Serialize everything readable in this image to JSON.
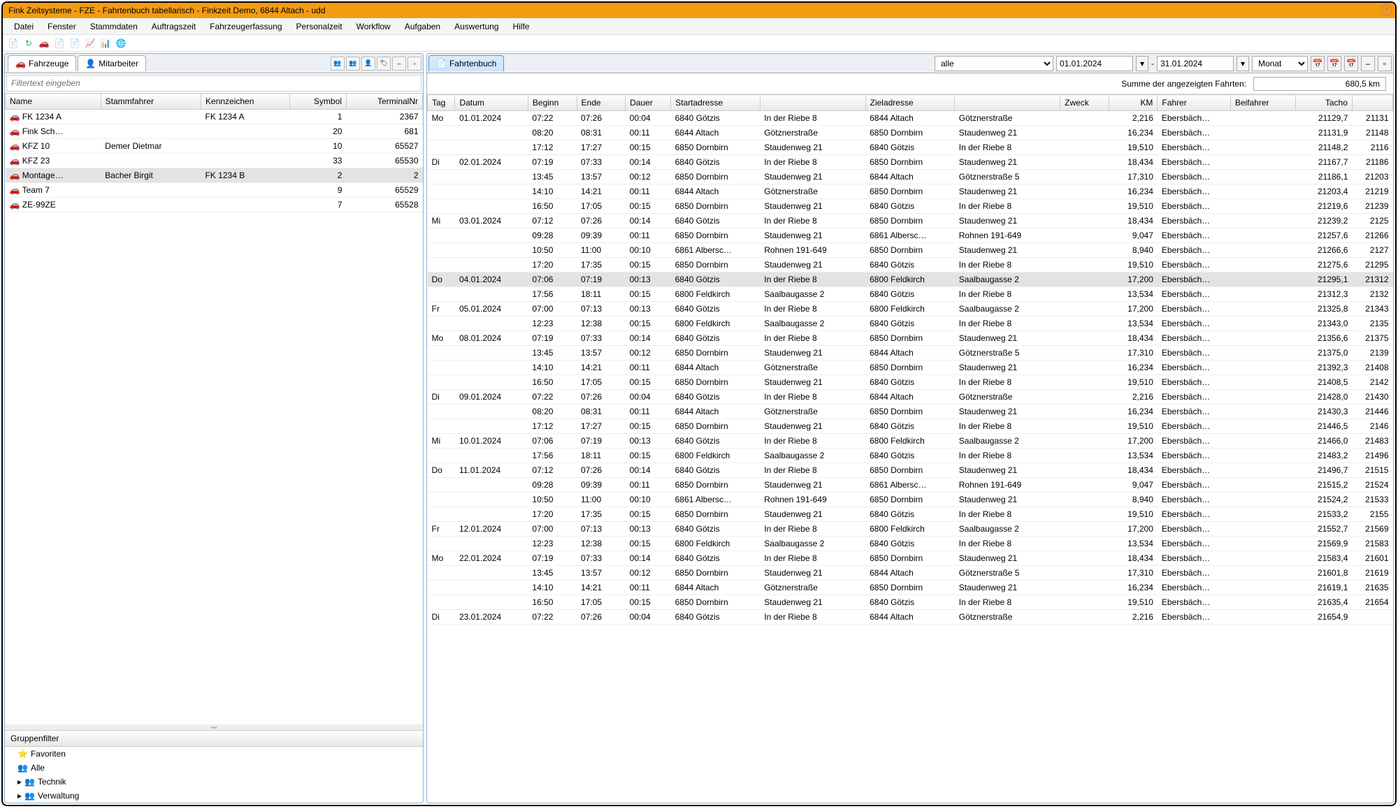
{
  "window_title": "Fink Zeitsysteme - FZE - Fahrtenbuch tabellarisch - Finkzeit Demo, 6844 Altach - udd",
  "menu": [
    "Datei",
    "Fenster",
    "Stammdaten",
    "Auftragszeit",
    "Fahrzeugerfassung",
    "Personalzeit",
    "Workflow",
    "Aufgaben",
    "Auswertung",
    "Hilfe"
  ],
  "left": {
    "tabs": [
      "Fahrzeuge",
      "Mitarbeiter"
    ],
    "filter_placeholder": "Filtertext eingeben",
    "cols": [
      "Name",
      "Stammfahrer",
      "Kennzeichen",
      "Symbol",
      "TerminalNr"
    ],
    "rows": [
      {
        "name": "FK 1234 A",
        "stamm": "",
        "kenn": "FK 1234 A",
        "sym": "1",
        "tnr": "2367"
      },
      {
        "name": "Fink Sch…",
        "stamm": "",
        "kenn": "",
        "sym": "20",
        "tnr": "681"
      },
      {
        "name": "KFZ 10",
        "stamm": "Demer Dietmar",
        "kenn": "",
        "sym": "10",
        "tnr": "65527"
      },
      {
        "name": "KFZ 23",
        "stamm": "",
        "kenn": "",
        "sym": "33",
        "tnr": "65530"
      },
      {
        "name": "Montage…",
        "stamm": "Bacher Birgit",
        "kenn": "FK 1234 B",
        "sym": "2",
        "tnr": "2",
        "sel": true
      },
      {
        "name": "Team 7",
        "stamm": "",
        "kenn": "",
        "sym": "9",
        "tnr": "65529"
      },
      {
        "name": "ZE-99ZE",
        "stamm": "",
        "kenn": "",
        "sym": "7",
        "tnr": "65528"
      }
    ],
    "group_header": "Gruppenfilter",
    "group_items": [
      "Favoriten",
      "Alle",
      "Technik",
      "Verwaltung"
    ]
  },
  "right": {
    "tab": "Fahrtenbuch",
    "filter_sel": "alle",
    "date_from": "01.01.2024",
    "date_to": "31.01.2024",
    "period": "Monat",
    "sum_label": "Summe der angezeigten Fahrten:",
    "sum_value": "680,5 km",
    "cols": [
      "Tag",
      "Datum",
      "Beginn",
      "Ende",
      "Dauer",
      "Startadresse",
      "",
      "Zieladresse",
      "",
      "Zweck",
      "KM",
      "Fahrer",
      "Beifahrer",
      "Tacho",
      ""
    ],
    "rows": [
      [
        "Mo",
        "01.01.2024",
        "07:22",
        "07:26",
        "00:04",
        "6840 Götzis",
        "In der Riebe 8",
        "6844 Altach",
        "Götznerstraße",
        "",
        "2,216",
        "Ebersbäch…",
        "",
        "21129,7",
        "21131"
      ],
      [
        "",
        "",
        "08:20",
        "08:31",
        "00:11",
        "6844 Altach",
        "Götznerstraße",
        "6850 Dornbirn",
        "Staudenweg 21",
        "",
        "16,234",
        "Ebersbäch…",
        "",
        "21131,9",
        "21148"
      ],
      [
        "",
        "",
        "17:12",
        "17:27",
        "00:15",
        "6850 Dornbirn",
        "Staudenweg 21",
        "6840 Götzis",
        "In der Riebe 8",
        "",
        "19,510",
        "Ebersbäch…",
        "",
        "21148,2",
        "2116"
      ],
      [
        "Di",
        "02.01.2024",
        "07:19",
        "07:33",
        "00:14",
        "6840 Götzis",
        "In der Riebe 8",
        "6850 Dornbirn",
        "Staudenweg 21",
        "",
        "18,434",
        "Ebersbäch…",
        "",
        "21167,7",
        "21186"
      ],
      [
        "",
        "",
        "13:45",
        "13:57",
        "00:12",
        "6850 Dornbirn",
        "Staudenweg 21",
        "6844 Altach",
        "Götznerstraße 5",
        "",
        "17,310",
        "Ebersbäch…",
        "",
        "21186,1",
        "21203"
      ],
      [
        "",
        "",
        "14:10",
        "14:21",
        "00:11",
        "6844 Altach",
        "Götznerstraße",
        "6850 Dornbirn",
        "Staudenweg 21",
        "",
        "16,234",
        "Ebersbäch…",
        "",
        "21203,4",
        "21219"
      ],
      [
        "",
        "",
        "16:50",
        "17:05",
        "00:15",
        "6850 Dornbirn",
        "Staudenweg 21",
        "6840 Götzis",
        "In der Riebe 8",
        "",
        "19,510",
        "Ebersbäch…",
        "",
        "21219,6",
        "21239"
      ],
      [
        "Mi",
        "03.01.2024",
        "07:12",
        "07:26",
        "00:14",
        "6840 Götzis",
        "In der Riebe 8",
        "6850 Dornbirn",
        "Staudenweg 21",
        "",
        "18,434",
        "Ebersbäch…",
        "",
        "21239,2",
        "2125"
      ],
      [
        "",
        "",
        "09:28",
        "09:39",
        "00:11",
        "6850 Dornbirn",
        "Staudenweg 21",
        "6861 Albersc…",
        "Rohnen 191-649",
        "",
        "9,047",
        "Ebersbäch…",
        "",
        "21257,6",
        "21266"
      ],
      [
        "",
        "",
        "10:50",
        "11:00",
        "00:10",
        "6861 Albersc…",
        "Rohnen 191-649",
        "6850 Dornbirn",
        "Staudenweg 21",
        "",
        "8,940",
        "Ebersbäch…",
        "",
        "21266,6",
        "2127"
      ],
      [
        "",
        "",
        "17:20",
        "17:35",
        "00:15",
        "6850 Dornbirn",
        "Staudenweg 21",
        "6840 Götzis",
        "In der Riebe 8",
        "",
        "19,510",
        "Ebersbäch…",
        "",
        "21275,6",
        "21295"
      ],
      [
        "Do",
        "04.01.2024",
        "07:06",
        "07:19",
        "00:13",
        "6840 Götzis",
        "In der Riebe 8",
        "6800 Feldkirch",
        "Saalbaugasse 2",
        "",
        "17,200",
        "Ebersbäch…",
        "",
        "21295,1",
        "21312"
      ],
      [
        "",
        "",
        "17:56",
        "18:11",
        "00:15",
        "6800 Feldkirch",
        "Saalbaugasse 2",
        "6840 Götzis",
        "In der Riebe 8",
        "",
        "13,534",
        "Ebersbäch…",
        "",
        "21312,3",
        "2132"
      ],
      [
        "Fr",
        "05.01.2024",
        "07:00",
        "07:13",
        "00:13",
        "6840 Götzis",
        "In der Riebe 8",
        "6800 Feldkirch",
        "Saalbaugasse 2",
        "",
        "17,200",
        "Ebersbäch…",
        "",
        "21325,8",
        "21343"
      ],
      [
        "",
        "",
        "12:23",
        "12:38",
        "00:15",
        "6800 Feldkirch",
        "Saalbaugasse 2",
        "6840 Götzis",
        "In der Riebe 8",
        "",
        "13,534",
        "Ebersbäch…",
        "",
        "21343,0",
        "2135"
      ],
      [
        "Mo",
        "08.01.2024",
        "07:19",
        "07:33",
        "00:14",
        "6840 Götzis",
        "In der Riebe 8",
        "6850 Dornbirn",
        "Staudenweg 21",
        "",
        "18,434",
        "Ebersbäch…",
        "",
        "21356,6",
        "21375"
      ],
      [
        "",
        "",
        "13:45",
        "13:57",
        "00:12",
        "6850 Dornbirn",
        "Staudenweg 21",
        "6844 Altach",
        "Götznerstraße 5",
        "",
        "17,310",
        "Ebersbäch…",
        "",
        "21375,0",
        "2139"
      ],
      [
        "",
        "",
        "14:10",
        "14:21",
        "00:11",
        "6844 Altach",
        "Götznerstraße",
        "6850 Dornbirn",
        "Staudenweg 21",
        "",
        "16,234",
        "Ebersbäch…",
        "",
        "21392,3",
        "21408"
      ],
      [
        "",
        "",
        "16:50",
        "17:05",
        "00:15",
        "6850 Dornbirn",
        "Staudenweg 21",
        "6840 Götzis",
        "In der Riebe 8",
        "",
        "19,510",
        "Ebersbäch…",
        "",
        "21408,5",
        "2142"
      ],
      [
        "Di",
        "09.01.2024",
        "07:22",
        "07:26",
        "00:04",
        "6840 Götzis",
        "In der Riebe 8",
        "6844 Altach",
        "Götznerstraße",
        "",
        "2,216",
        "Ebersbäch…",
        "",
        "21428,0",
        "21430"
      ],
      [
        "",
        "",
        "08:20",
        "08:31",
        "00:11",
        "6844 Altach",
        "Götznerstraße",
        "6850 Dornbirn",
        "Staudenweg 21",
        "",
        "16,234",
        "Ebersbäch…",
        "",
        "21430,3",
        "21446"
      ],
      [
        "",
        "",
        "17:12",
        "17:27",
        "00:15",
        "6850 Dornbirn",
        "Staudenweg 21",
        "6840 Götzis",
        "In der Riebe 8",
        "",
        "19,510",
        "Ebersbäch…",
        "",
        "21446,5",
        "2146"
      ],
      [
        "Mi",
        "10.01.2024",
        "07:06",
        "07:19",
        "00:13",
        "6840 Götzis",
        "In der Riebe 8",
        "6800 Feldkirch",
        "Saalbaugasse 2",
        "",
        "17,200",
        "Ebersbäch…",
        "",
        "21466,0",
        "21483"
      ],
      [
        "",
        "",
        "17:56",
        "18:11",
        "00:15",
        "6800 Feldkirch",
        "Saalbaugasse 2",
        "6840 Götzis",
        "In der Riebe 8",
        "",
        "13,534",
        "Ebersbäch…",
        "",
        "21483,2",
        "21496"
      ],
      [
        "Do",
        "11.01.2024",
        "07:12",
        "07:26",
        "00:14",
        "6840 Götzis",
        "In der Riebe 8",
        "6850 Dornbirn",
        "Staudenweg 21",
        "",
        "18,434",
        "Ebersbäch…",
        "",
        "21496,7",
        "21515"
      ],
      [
        "",
        "",
        "09:28",
        "09:39",
        "00:11",
        "6850 Dornbirn",
        "Staudenweg 21",
        "6861 Albersc…",
        "Rohnen 191-649",
        "",
        "9,047",
        "Ebersbäch…",
        "",
        "21515,2",
        "21524"
      ],
      [
        "",
        "",
        "10:50",
        "11:00",
        "00:10",
        "6861 Albersc…",
        "Rohnen 191-649",
        "6850 Dornbirn",
        "Staudenweg 21",
        "",
        "8,940",
        "Ebersbäch…",
        "",
        "21524,2",
        "21533"
      ],
      [
        "",
        "",
        "17:20",
        "17:35",
        "00:15",
        "6850 Dornbirn",
        "Staudenweg 21",
        "6840 Götzis",
        "In der Riebe 8",
        "",
        "19,510",
        "Ebersbäch…",
        "",
        "21533,2",
        "2155"
      ],
      [
        "Fr",
        "12.01.2024",
        "07:00",
        "07:13",
        "00:13",
        "6840 Götzis",
        "In der Riebe 8",
        "6800 Feldkirch",
        "Saalbaugasse 2",
        "",
        "17,200",
        "Ebersbäch…",
        "",
        "21552,7",
        "21569"
      ],
      [
        "",
        "",
        "12:23",
        "12:38",
        "00:15",
        "6800 Feldkirch",
        "Saalbaugasse 2",
        "6840 Götzis",
        "In der Riebe 8",
        "",
        "13,534",
        "Ebersbäch…",
        "",
        "21569,9",
        "21583"
      ],
      [
        "Mo",
        "22.01.2024",
        "07:19",
        "07:33",
        "00:14",
        "6840 Götzis",
        "In der Riebe 8",
        "6850 Dornbirn",
        "Staudenweg 21",
        "",
        "18,434",
        "Ebersbäch…",
        "",
        "21583,4",
        "21601"
      ],
      [
        "",
        "",
        "13:45",
        "13:57",
        "00:12",
        "6850 Dornbirn",
        "Staudenweg 21",
        "6844 Altach",
        "Götznerstraße 5",
        "",
        "17,310",
        "Ebersbäch…",
        "",
        "21601,8",
        "21619"
      ],
      [
        "",
        "",
        "14:10",
        "14:21",
        "00:11",
        "6844 Altach",
        "Götznerstraße",
        "6850 Dornbirn",
        "Staudenweg 21",
        "",
        "16,234",
        "Ebersbäch…",
        "",
        "21619,1",
        "21635"
      ],
      [
        "",
        "",
        "16:50",
        "17:05",
        "00:15",
        "6850 Dornbirn",
        "Staudenweg 21",
        "6840 Götzis",
        "In der Riebe 8",
        "",
        "19,510",
        "Ebersbäch…",
        "",
        "21635,4",
        "21654"
      ],
      [
        "Di",
        "23.01.2024",
        "07:22",
        "07:26",
        "00:04",
        "6840 Götzis",
        "In der Riebe 8",
        "6844 Altach",
        "Götznerstraße",
        "",
        "2,216",
        "Ebersbäch…",
        "",
        "21654,9",
        ""
      ]
    ]
  }
}
